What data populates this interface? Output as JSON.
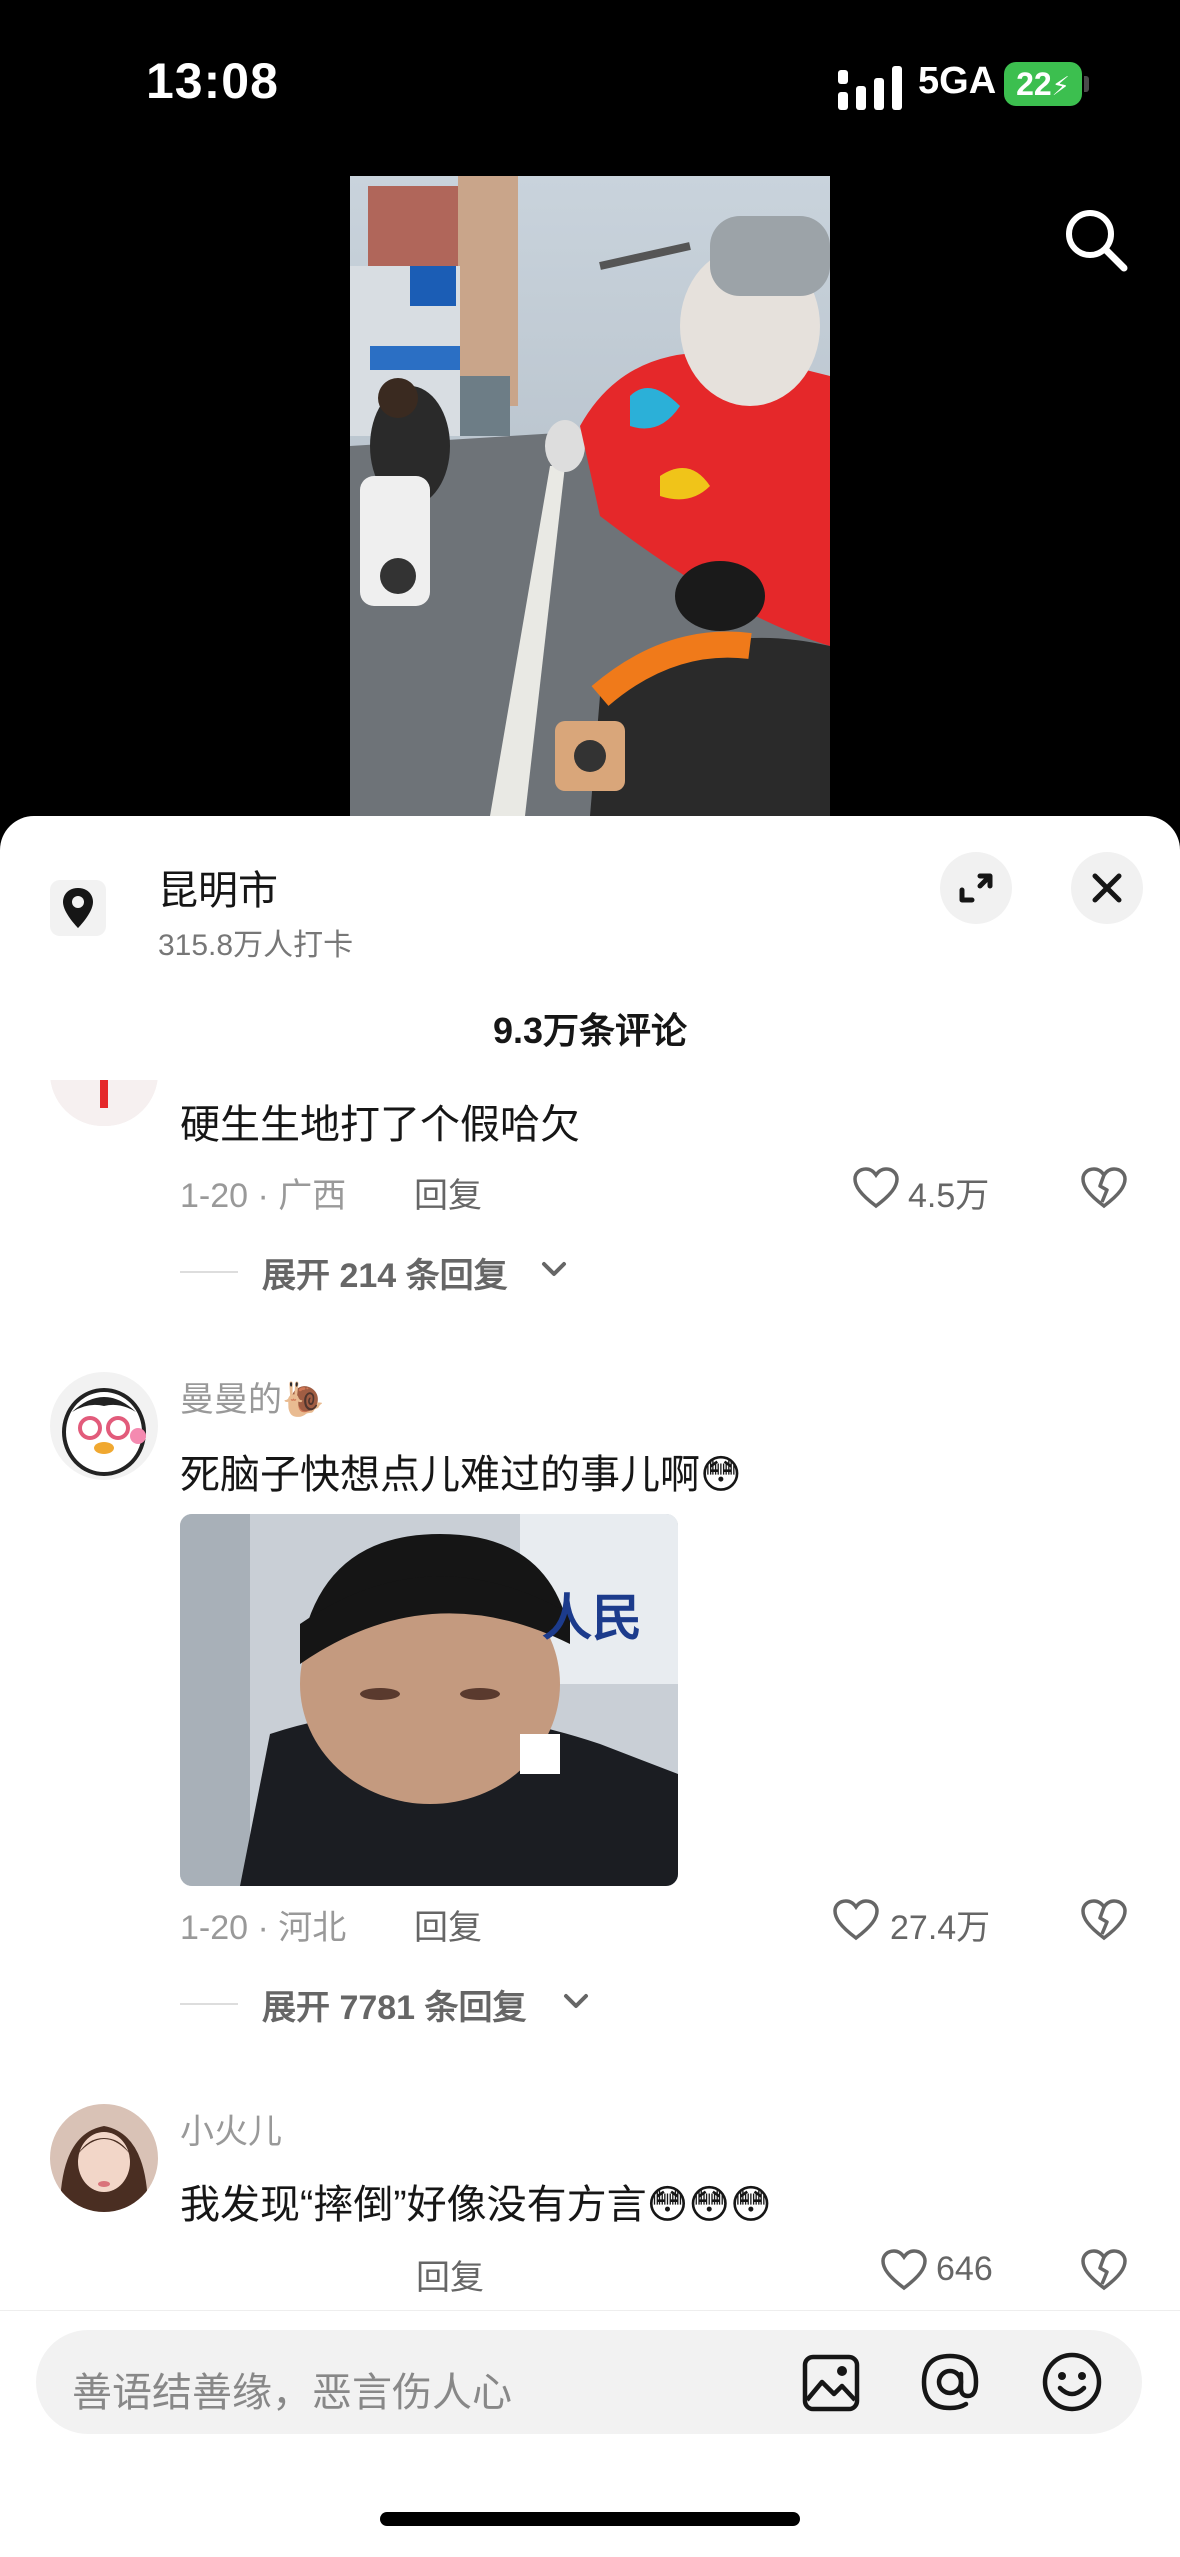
{
  "status_bar": {
    "time": "13:08",
    "network": "5GA",
    "battery": "22"
  },
  "location": {
    "name": "昆明市",
    "subtitle": "315.8万人打卡"
  },
  "comments_header": {
    "count": "9.3万条评论"
  },
  "comments": [
    {
      "text": "硬生生地打了个假哈欠",
      "meta": "1-20 · 广西",
      "reply_label": "回复",
      "likes": "4.5万",
      "expand_label": "展开 214 条回复"
    },
    {
      "username": "曼曼的🐌",
      "text": "死脑子快想点儿难过的事儿啊😳",
      "image_text": "人民",
      "meta": "1-20 · 河北",
      "reply_label": "回复",
      "likes": "27.4万",
      "expand_label": "展开 7781 条回复"
    },
    {
      "username": "小火儿",
      "text": "我发现“摔倒”好像没有方言😳😳😳",
      "reply_label": "回复",
      "likes": "646"
    }
  ],
  "input": {
    "placeholder": "善语结善缘，恶言伤人心"
  },
  "colors": {
    "battery": "#3cbf4f",
    "accent_red": "#e5282a",
    "sheet": "#ffffff"
  },
  "icons": [
    "signal-icon",
    "search-icon",
    "location-pin-icon",
    "expand-icon",
    "close-icon",
    "heart-icon",
    "dislike-icon",
    "chevron-down-icon",
    "image-icon",
    "at-icon",
    "emoji-icon"
  ]
}
